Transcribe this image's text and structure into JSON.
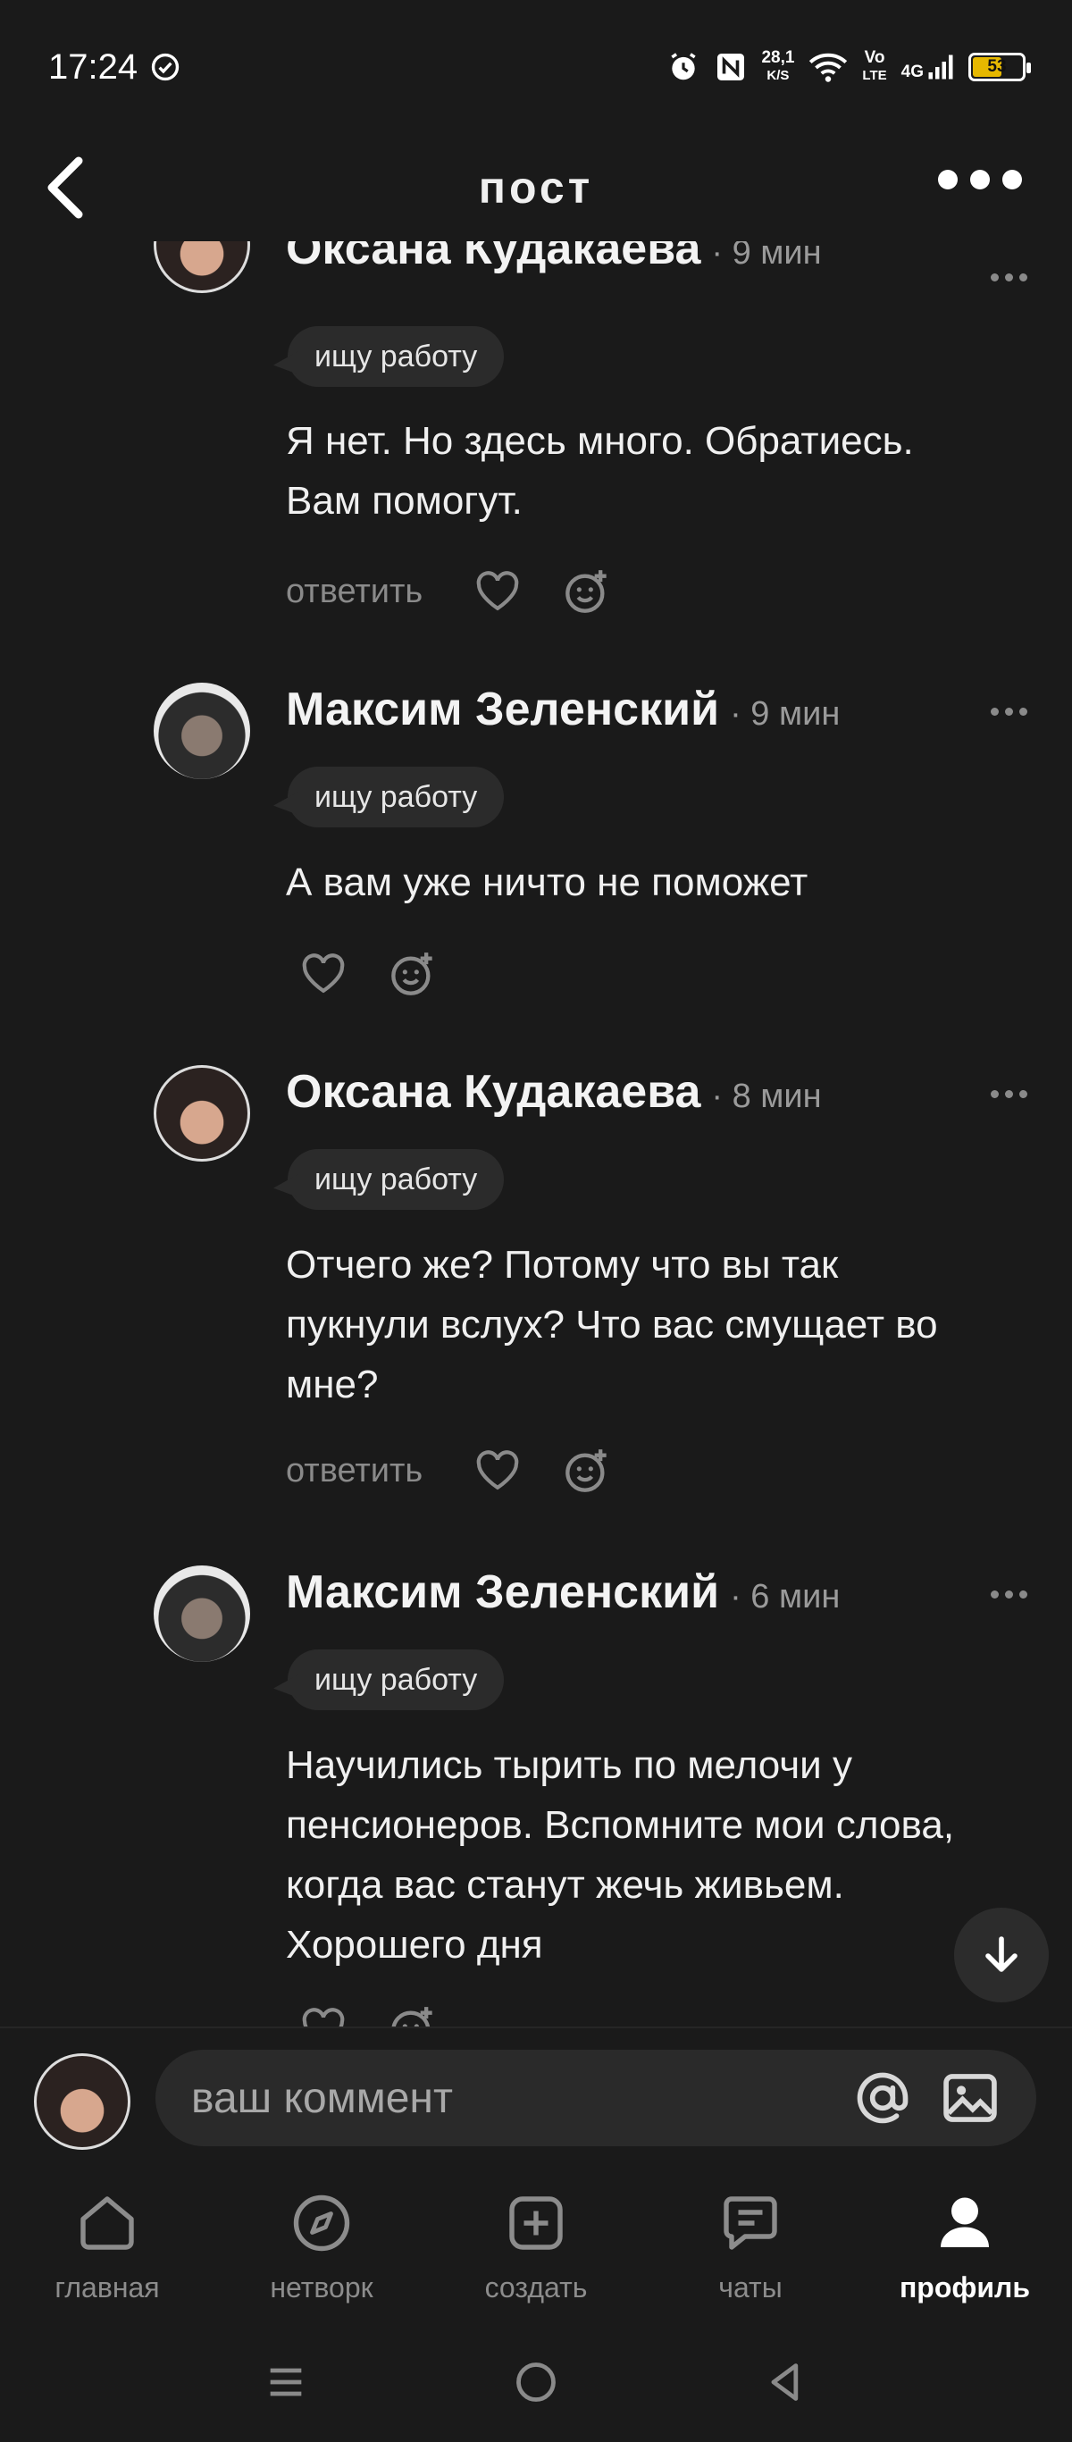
{
  "status": {
    "time": "17:24",
    "net_speed_value": "28,1",
    "net_speed_unit": "K/S",
    "volte_top": "Vo",
    "volte_bottom": "LTE",
    "network": "4G",
    "battery": "53"
  },
  "header": {
    "title": "пост"
  },
  "comments": [
    {
      "author": "Оксана Кудакаева",
      "time": "· 9 мин",
      "tag": "ищу работу",
      "text_lines": [
        "Я нет. Но здесь много. Обратиесь.",
        "Вам помогут."
      ],
      "reply": "ответить"
    },
    {
      "author": "Максим Зеленский",
      "time": "· 9 мин",
      "tag": "ищу работу",
      "text_lines": [
        "А вам уже ничто не поможет"
      ]
    },
    {
      "author": "Оксана Кудакаева",
      "time": "· 8 мин",
      "tag": "ищу работу",
      "text_lines": [
        "Отчего же? Потому что вы так",
        "пукнули вслух? Что вас смущает во",
        "мне?"
      ],
      "reply": "ответить"
    },
    {
      "author": "Максим Зеленский",
      "time": "· 6 мин",
      "tag": "ищу работу",
      "text_lines": [
        "Научились тырить по мелочи у",
        "пенсионеров. Вспомните мои слова,",
        "когда вас станут жечь живьем.",
        "Хорошего дня"
      ]
    }
  ],
  "composer": {
    "placeholder": "ваш коммент"
  },
  "tabs": [
    {
      "label": "главная",
      "icon": "home-icon"
    },
    {
      "label": "нетворк",
      "icon": "compass-icon"
    },
    {
      "label": "создать",
      "icon": "plus-square-icon"
    },
    {
      "label": "чаты",
      "icon": "chat-icon"
    },
    {
      "label": "профиль",
      "icon": "profile-icon",
      "active": true
    }
  ],
  "colors": {
    "background": "#1a1a1a",
    "surface": "#2b2b2b",
    "muted_text": "#8a8a8a",
    "battery": "#e6b800"
  }
}
